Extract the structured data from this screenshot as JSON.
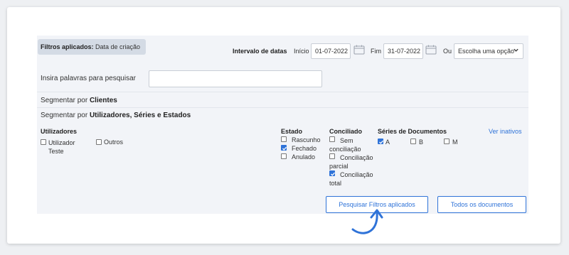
{
  "filter_chip": {
    "label": "Filtros aplicados:",
    "value": "Data de criação"
  },
  "date_range": {
    "label": "Intervalo de datas",
    "start_label": "Início",
    "start_value": "01-07-2022",
    "end_label": "Fim",
    "end_value": "31-07-2022",
    "or_label": "Ou",
    "select_value": "Escolha uma opção"
  },
  "search": {
    "label": "Insira palavras para pesquisar",
    "value": ""
  },
  "segment_clients": {
    "prefix": "Segmentar por",
    "bold": "Clientes"
  },
  "segment_users": {
    "prefix": "Segmentar por",
    "bold": "Utilizadores, Séries e Estados"
  },
  "utilizadores": {
    "title": "Utilizadores",
    "items": [
      {
        "label": "Utilizador Teste",
        "checked": false
      },
      {
        "label": "Outros",
        "checked": false
      }
    ]
  },
  "estado": {
    "title": "Estado",
    "items": [
      {
        "label": "Rascunho",
        "checked": false
      },
      {
        "label": "Fechado",
        "checked": true
      },
      {
        "label": "Anulado",
        "checked": false
      }
    ]
  },
  "conciliado": {
    "title": "Conciliado",
    "items": [
      {
        "label": "Sem conciliação",
        "checked": false
      },
      {
        "label": "Conciliação parcial",
        "checked": false
      },
      {
        "label": "Conciliação total",
        "checked": true
      }
    ]
  },
  "series": {
    "title": "Séries de Documentos",
    "link": "Ver inativos",
    "items": [
      {
        "label": "A",
        "checked": true
      },
      {
        "label": "B",
        "checked": false
      },
      {
        "label": "M",
        "checked": false
      }
    ]
  },
  "buttons": {
    "search_applied": "Pesquisar Filtros aplicados",
    "all_documents": "Todos os documentos"
  },
  "colors": {
    "accent": "#2f73d8",
    "panel": "#f2f4f8",
    "chip": "#d4dbe5"
  }
}
